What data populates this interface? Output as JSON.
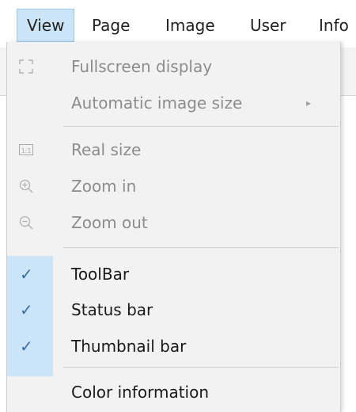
{
  "menubar": {
    "items": [
      {
        "label": "View",
        "active": true
      },
      {
        "label": "Page"
      },
      {
        "label": "Image"
      },
      {
        "label": "User"
      },
      {
        "label": "Info"
      }
    ]
  },
  "menu": {
    "items": [
      {
        "label": "Fullscreen display",
        "icon": "fullscreen-icon",
        "enabled": false
      },
      {
        "label": "Automatic image size",
        "icon": null,
        "enabled": false,
        "submenu": true
      },
      {
        "label": "Real size",
        "icon": "real-size-icon",
        "enabled": false
      },
      {
        "label": "Zoom in",
        "icon": "zoom-in-icon",
        "enabled": false
      },
      {
        "label": "Zoom out",
        "icon": "zoom-out-icon",
        "enabled": false
      },
      {
        "label": "ToolBar",
        "checked": true,
        "enabled": true
      },
      {
        "label": "Status bar",
        "checked": true,
        "enabled": true
      },
      {
        "label": "Thumbnail bar",
        "checked": true,
        "enabled": true
      },
      {
        "label": "Color information",
        "enabled": true
      }
    ],
    "check_glyph": "✓",
    "submenu_arrow": "▸"
  },
  "colors": {
    "menu_bg": "#f2f2f2",
    "highlight": "#cce4f7",
    "highlight_border": "#99c9ef",
    "disabled_text": "#8c8c8c",
    "text": "#1a1a1a"
  }
}
